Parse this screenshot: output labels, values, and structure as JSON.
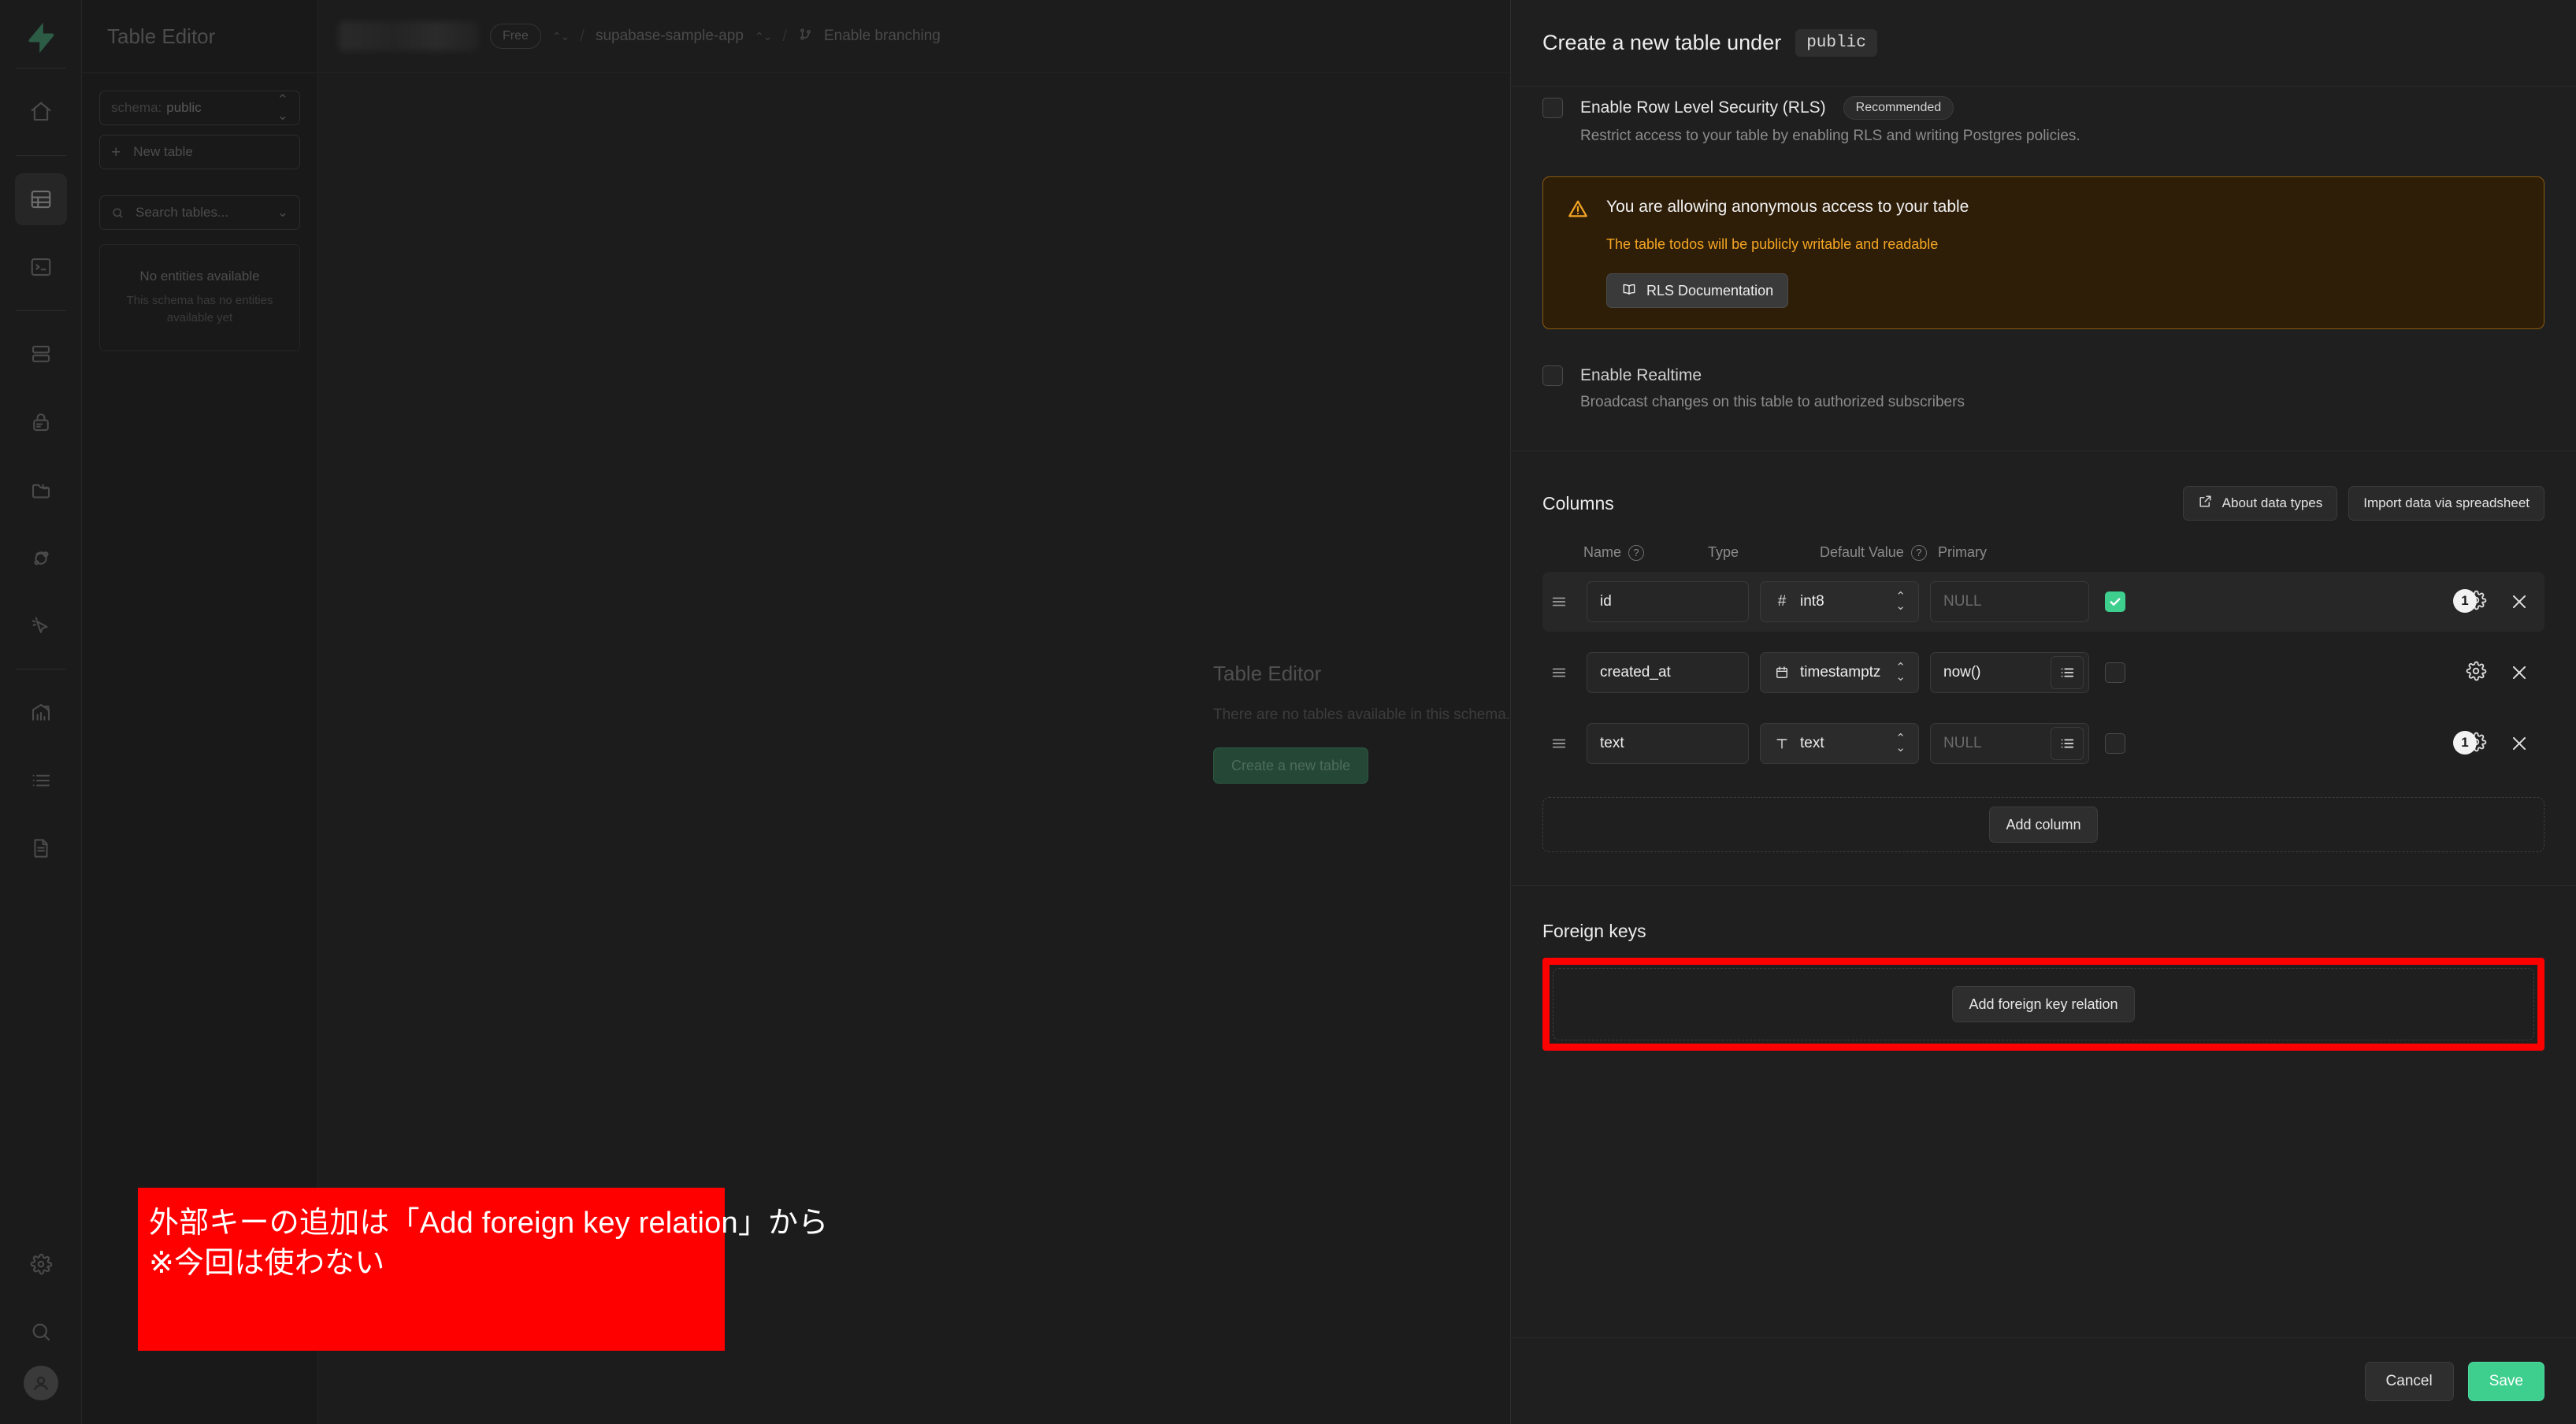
{
  "rail": {
    "logo": "supabase-logo",
    "items": [
      {
        "name": "home-icon"
      },
      {
        "name": "table-editor-icon",
        "active": true
      },
      {
        "name": "sql-editor-icon"
      },
      {
        "name": "database-icon"
      },
      {
        "name": "authentication-icon"
      },
      {
        "name": "storage-icon"
      },
      {
        "name": "edge-functions-icon"
      },
      {
        "name": "realtime-icon"
      },
      {
        "name": "reports-icon"
      },
      {
        "name": "logs-icon"
      },
      {
        "name": "api-docs-icon"
      }
    ],
    "bottom": [
      {
        "name": "settings-icon"
      },
      {
        "name": "search-icon"
      },
      {
        "name": "account-avatar"
      }
    ]
  },
  "sidebar": {
    "title": "Table Editor",
    "schema_label": "schema:",
    "schema_value": "public",
    "new_table_label": "New table",
    "search_placeholder": "Search tables...",
    "empty_title": "No entities available",
    "empty_sub": "This schema has no entities available yet"
  },
  "topbar": {
    "plan": "Free",
    "project": "supabase-sample-app",
    "branching": "Enable branching",
    "separator": "/"
  },
  "main_empty": {
    "title": "Table Editor",
    "subtitle": "There are no tables available in this schema.",
    "cta": "Create a new table"
  },
  "panel": {
    "title": "Create a new table under",
    "schema": "public",
    "rls": {
      "label": "Enable Row Level Security (RLS)",
      "badge": "Recommended",
      "desc": "Restrict access to your table by enabling RLS and writing Postgres policies.",
      "checked": false
    },
    "warning": {
      "title": "You are allowing anonymous access to your table",
      "sub": "The table todos will be publicly writable and readable",
      "button": "RLS Documentation",
      "bg": "#2e1e08",
      "border": "#8a5a10",
      "accent": "#f5a524"
    },
    "realtime": {
      "label": "Enable Realtime",
      "desc": "Broadcast changes on this table to authorized subscribers",
      "checked": false
    },
    "columns": {
      "heading": "Columns",
      "about_button": "About data types",
      "import_button": "Import data via spreadsheet",
      "headers": {
        "name": "Name",
        "type": "Type",
        "default": "Default Value",
        "primary": "Primary"
      },
      "rows": [
        {
          "name": "id",
          "type": "int8",
          "type_icon": "hash-icon",
          "default": "NULL",
          "default_is_placeholder": true,
          "primary": true,
          "has_list_button": false,
          "badge_count": "1",
          "highlighted": true
        },
        {
          "name": "created_at",
          "type": "timestamptz",
          "type_icon": "calendar-icon",
          "default": "now()",
          "default_is_placeholder": false,
          "primary": false,
          "has_list_button": true,
          "badge_count": "",
          "highlighted": false
        },
        {
          "name": "text",
          "type": "text",
          "type_icon": "text-icon",
          "default": "NULL",
          "default_is_placeholder": true,
          "primary": false,
          "has_list_button": true,
          "badge_count": "1",
          "highlighted": false
        }
      ],
      "add_column_button": "Add column"
    },
    "foreign_keys": {
      "heading": "Foreign keys",
      "add_button": "Add foreign key relation",
      "highlight_color": "#ff0000"
    },
    "footer": {
      "cancel": "Cancel",
      "save": "Save",
      "save_color": "#3ecf8e"
    }
  },
  "annotation": {
    "line1": "外部キーの追加は「Add foreign key relation」から",
    "line2": "※今回は使わない",
    "bg": "#ff0000",
    "fg": "#ffffff"
  }
}
